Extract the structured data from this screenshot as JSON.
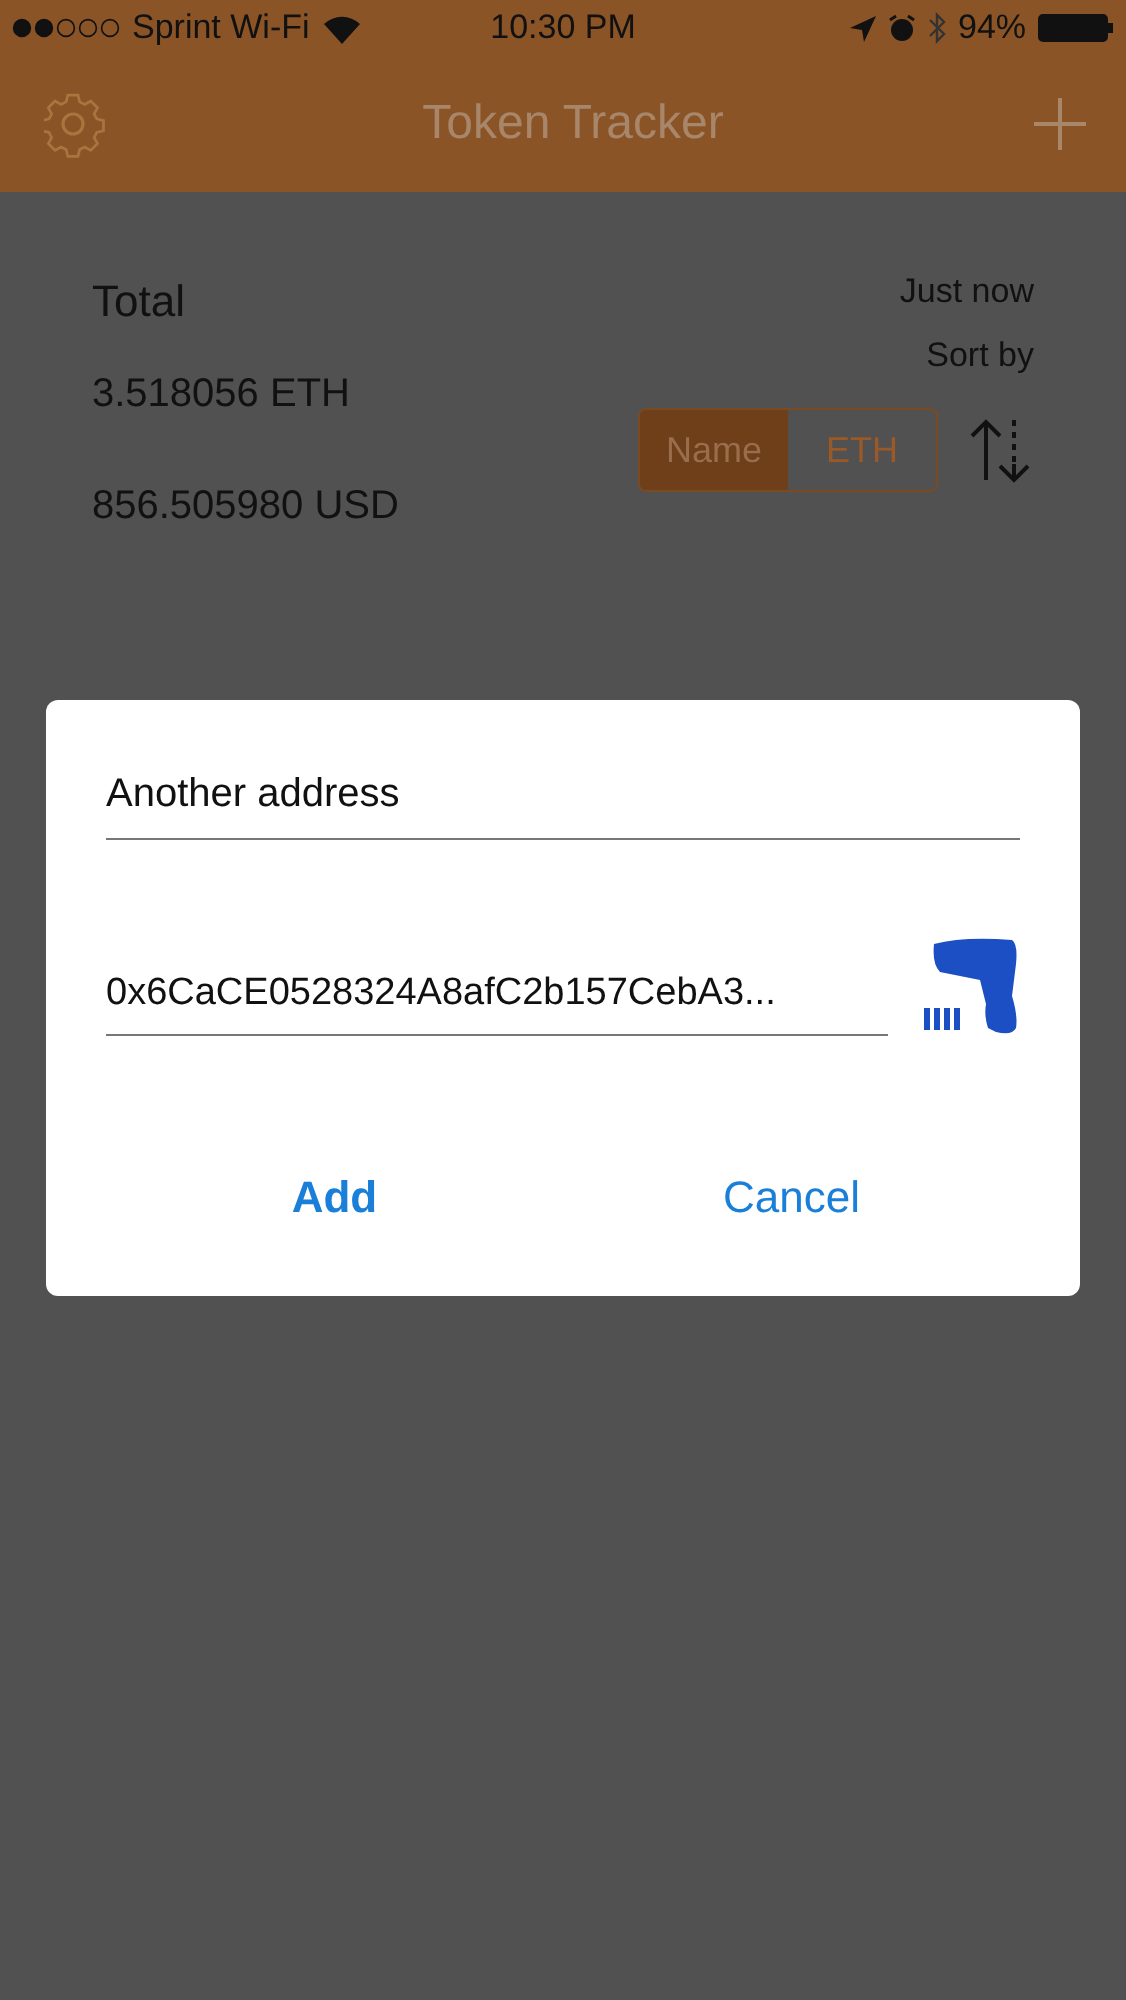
{
  "status_bar": {
    "carrier": "Sprint Wi-Fi",
    "time": "10:30 PM",
    "battery": "94%"
  },
  "nav_bar": {
    "title": "Token Tracker"
  },
  "summary": {
    "title": "Total",
    "eth": "3.518056 ETH",
    "usd": "856.505980 USD",
    "updated": "Just now",
    "sort_label": "Sort by",
    "sort_options": [
      {
        "label": "Name",
        "selected": true
      },
      {
        "label": "ETH",
        "selected": false
      }
    ]
  },
  "dialog": {
    "name_field": {
      "value": "Another address"
    },
    "address_field": {
      "value": "0x6CaCE0528324A8afC2b157CebA3..."
    },
    "buttons": [
      {
        "label": "Add",
        "kind": "primary"
      },
      {
        "label": "Cancel",
        "kind": "secondary"
      }
    ]
  }
}
